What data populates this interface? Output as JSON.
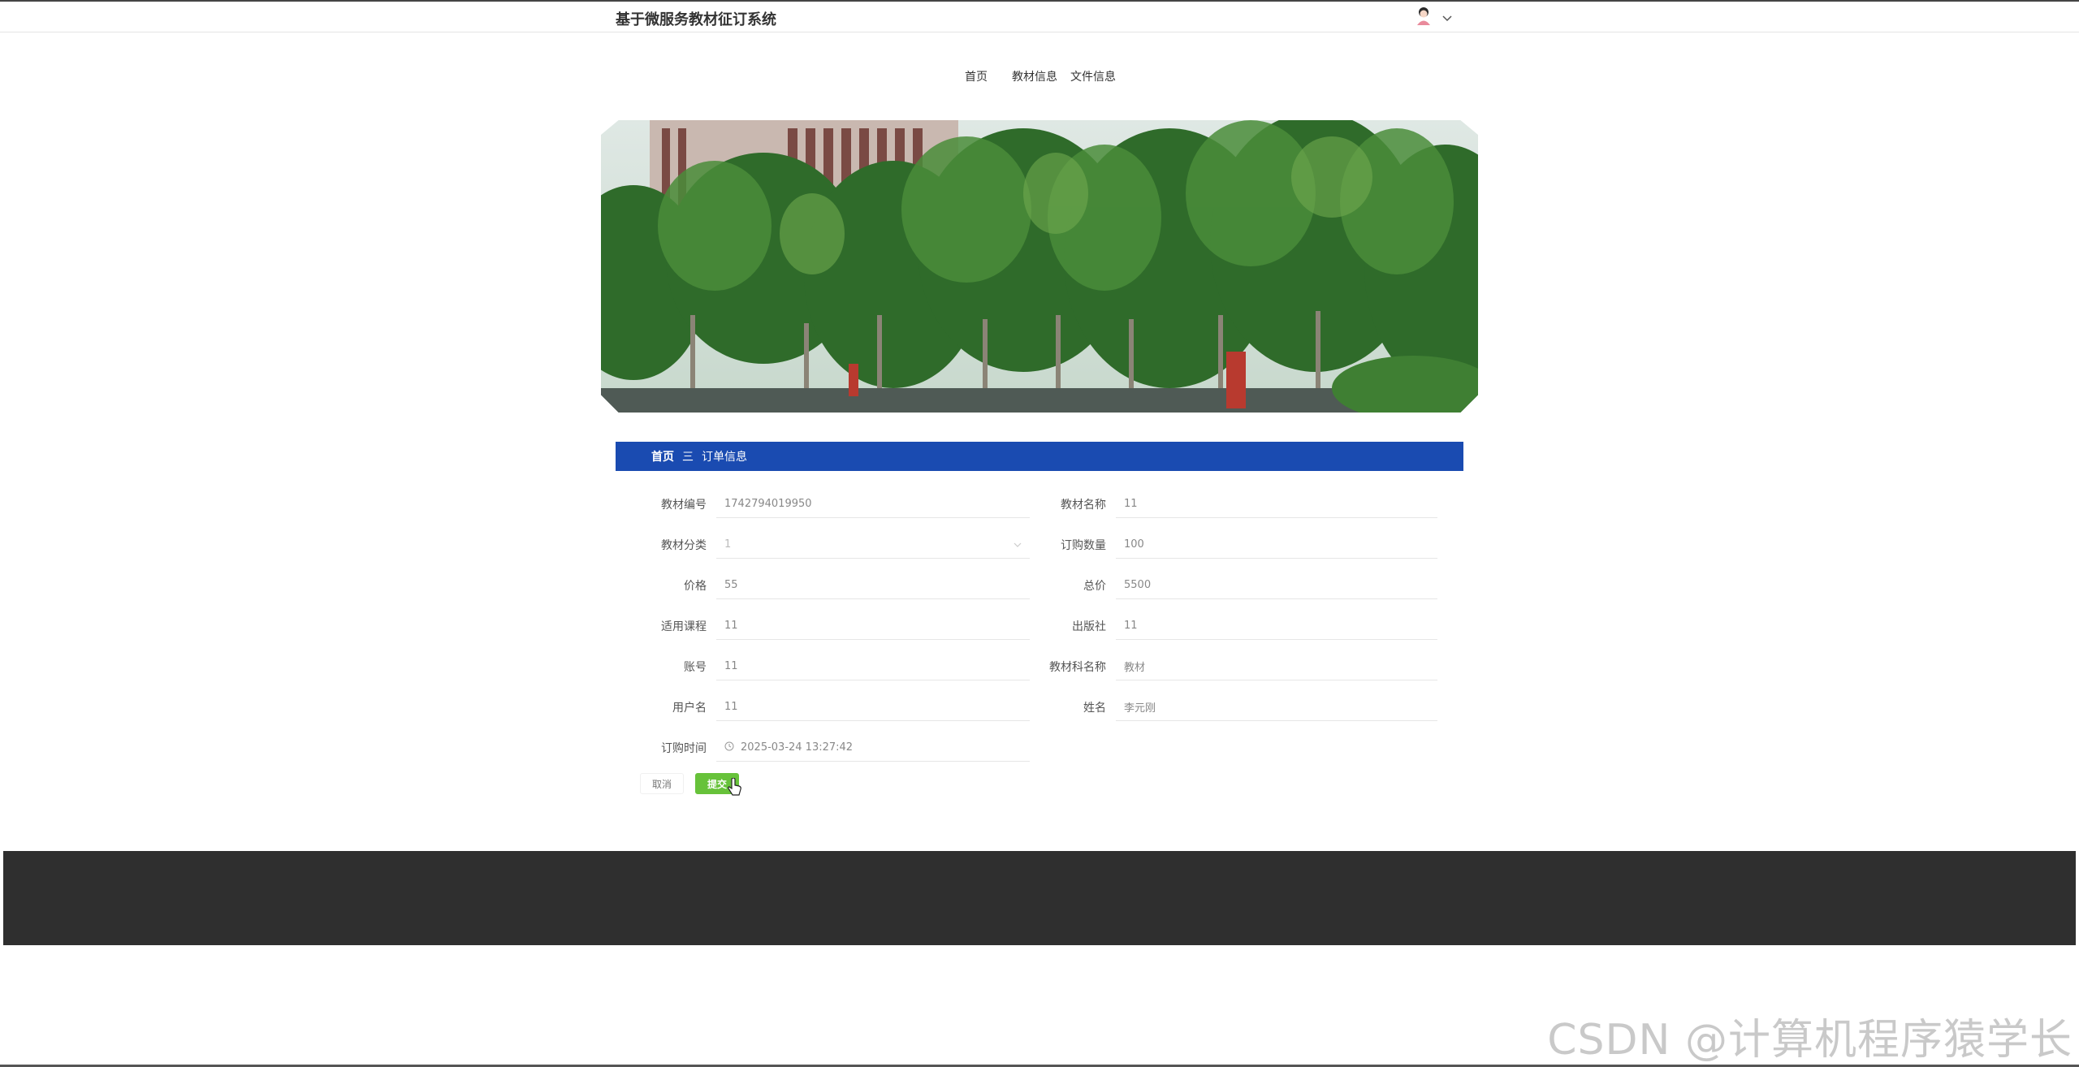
{
  "header": {
    "site_title": "基于微服务教材征订系统"
  },
  "nav": {
    "items": [
      {
        "label": "首页"
      },
      {
        "label": "教材信息"
      },
      {
        "label": "文件信息"
      }
    ]
  },
  "breadcrumb": {
    "home": "首页",
    "separator": "三",
    "current": "订单信息"
  },
  "form": {
    "fields": [
      {
        "label": "教材编号",
        "value": "1742794019950"
      },
      {
        "label": "教材名称",
        "value": "11"
      },
      {
        "label": "教材分类",
        "value": "1"
      },
      {
        "label": "订购数量",
        "value": "100"
      },
      {
        "label": "价格",
        "value": "55"
      },
      {
        "label": "总价",
        "value": "5500"
      },
      {
        "label": "适用课程",
        "value": "11"
      },
      {
        "label": "出版社",
        "value": "11"
      },
      {
        "label": "账号",
        "value": "11"
      },
      {
        "label": "教材科名称",
        "value": "教材"
      },
      {
        "label": "用户名",
        "value": "11"
      },
      {
        "label": "姓名",
        "value": "李元刚"
      },
      {
        "label": "订购时间",
        "value": "2025-03-24 13:27:42"
      }
    ],
    "cancel_label": "取消",
    "submit_label": "提交"
  },
  "watermark": "CSDN @计算机程序猿学长",
  "colors": {
    "breadcrumb_bg": "#1a4bb1",
    "submit_bg": "#67c23a",
    "footer_bg": "#2f2f2f"
  }
}
